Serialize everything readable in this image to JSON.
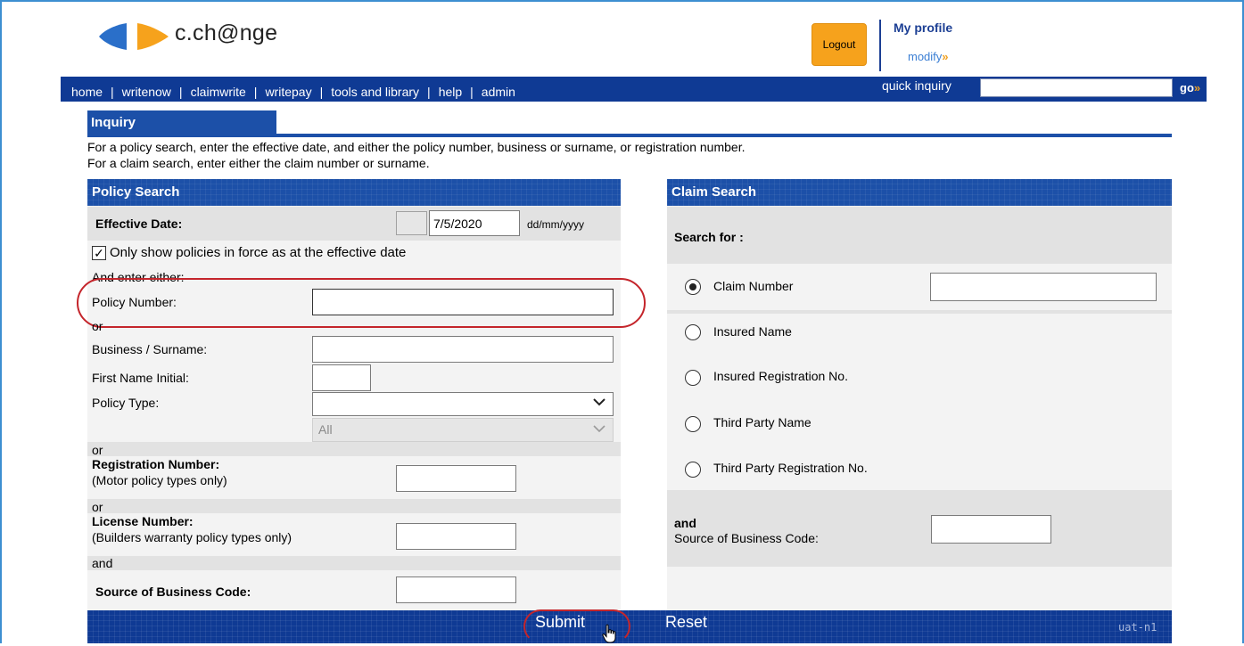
{
  "header": {
    "logo_text": "c.ch@nge",
    "logout_label": "Logout",
    "my_profile_label": "My profile",
    "modify_label": "modify",
    "modify_arrow": "»"
  },
  "nav": {
    "items": [
      "home",
      "writenow",
      "claimwrite",
      "writepay",
      "tools and library",
      "help",
      "admin"
    ],
    "quick_inquiry_label": "quick inquiry",
    "quick_inquiry_value": "",
    "go_label": "go",
    "go_arrow": "»"
  },
  "inquiry": {
    "title": "Inquiry",
    "instruction_policy": "For a policy search, enter the effective date, and either the policy number, business or surname, or registration number.",
    "instruction_claim": "For a claim search, enter either the claim number or surname."
  },
  "policy_search": {
    "title": "Policy Search",
    "effective_date_label": "Effective Date:",
    "effective_date_value": "7/5/2020",
    "date_format_hint": "dd/mm/yyyy",
    "only_inforce_label": "Only show policies in force as at the effective date",
    "only_inforce_checked": true,
    "and_enter_either": "And enter either:",
    "policy_number_label": "Policy Number:",
    "policy_number_value": "",
    "or_1": "or",
    "business_surname_label": "Business / Surname:",
    "business_surname_value": "",
    "first_name_initial_label": "First Name Initial:",
    "first_name_initial_value": "",
    "policy_type_label": "Policy Type:",
    "policy_type_value": "",
    "policy_subtype_value": "All",
    "or_2": "or",
    "registration_number_label": "Registration Number:",
    "registration_number_note": "(Motor policy types only)",
    "registration_number_value": "",
    "or_3": "or",
    "license_number_label": "License Number:",
    "license_number_note": "(Builders warranty policy types only)",
    "license_number_value": "",
    "and_label": "and",
    "source_business_label": "Source of Business Code:",
    "source_business_value": ""
  },
  "claim_search": {
    "title": "Claim Search",
    "search_for_label": "Search for :",
    "options": [
      "Claim Number",
      "Insured Name",
      "Insured Registration No.",
      "Third Party Name",
      "Third Party Registration No."
    ],
    "selected_option": "Claim Number",
    "claim_number_value": "",
    "and_label": "and",
    "source_business_label": "Source of Business Code:",
    "source_business_value": ""
  },
  "footer": {
    "submit_label": "Submit",
    "reset_label": "Reset",
    "environment": "uat-n1"
  },
  "colors": {
    "nav_blue": "#0f3a94",
    "panel_header_blue": "#1c50a8",
    "logout_orange": "#f6a21c",
    "annotation_red": "#c4252b"
  }
}
